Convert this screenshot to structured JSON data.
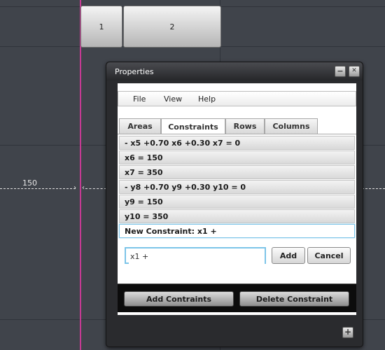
{
  "canvas": {
    "top_tabs": [
      "1",
      "2"
    ],
    "dimension_label": "150"
  },
  "window": {
    "title": "Properties",
    "minimize_glyph": "−",
    "close_glyph": "✕",
    "menu": [
      "File",
      "View",
      "Help"
    ],
    "tabs": [
      "Areas",
      "Constraints",
      "Rows",
      "Columns"
    ],
    "active_tab": "Constraints",
    "constraints": [
      "- x5 +0.70 x6 +0.30 x7 = 0",
      "x6 = 150",
      "x7 = 350",
      "- y8 +0.70 y9 +0.30 y10 = 0",
      "y9 = 150",
      "y10 = 350"
    ],
    "new_constraint_label": "New Constraint: x1 +",
    "input_value": "x1 +",
    "add_label": "Add",
    "cancel_label": "Cancel",
    "add_constraints_label": "Add Contraints",
    "delete_constraint_label": "Delete Constraint"
  },
  "plus_glyph": "+",
  "colors": {
    "guide": "#c53a93",
    "background": "#40444b",
    "selection": "#7cc4e8"
  }
}
